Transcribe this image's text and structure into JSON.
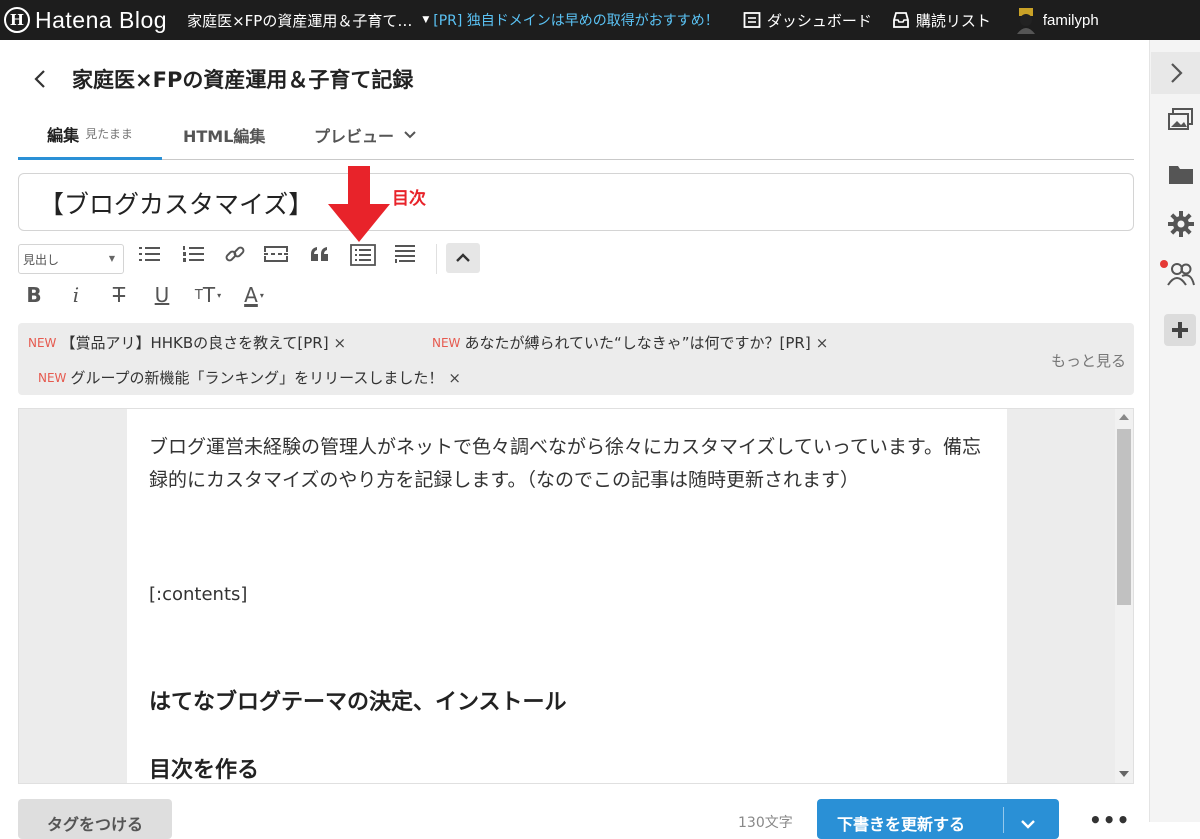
{
  "header": {
    "logo_mark": "H",
    "logo_text": "Hatena Blog",
    "blog_title": "家庭医×FPの資産運用＆子育て…",
    "pr_text": "[PR] 独自ドメインは早めの取得がおすすめ！",
    "nav": [
      {
        "label": "ダッシュボード",
        "icon": "dashboard-icon"
      },
      {
        "label": "購読リスト",
        "icon": "inbox-icon"
      }
    ],
    "username": "familyph"
  },
  "editor_header": {
    "blog_name": "家庭医×FPの資産運用＆子育て記録",
    "tabs": {
      "edit": "編集",
      "edit_sub": "見たまま",
      "html": "HTML編集",
      "preview": "プレビュー"
    }
  },
  "post": {
    "title": "【ブログカスタマイズ】",
    "annotation": "目次",
    "body": "ブログ運営未経験の管理人がネットで色々調べながら徐々にカスタマイズしていっています。備忘録的にカスタマイズのやり方を記録します。（なのでこの記事は随時更新されます）",
    "contents_tag": "[:contents]",
    "heading_1": "はてなブログテーマの決定、インストール",
    "heading_2": "目次を作る"
  },
  "toolbar": {
    "format_select": "見出し",
    "buttons": [
      "bulleted-list-icon",
      "numbered-list-icon",
      "link-icon",
      "more-separator-icon",
      "quote-icon",
      "table-of-contents-icon",
      "footnote-icon"
    ],
    "text_format": {
      "bold": "B",
      "italic": "i",
      "strike": "T",
      "underline": "U",
      "size": "T",
      "color": "A"
    }
  },
  "notices": {
    "badge": "NEW",
    "items": [
      "【賞品アリ】HHKBの良さを教えて[PR]",
      "あなたが縛られていた“しなきゃ”は何ですか？[PR]",
      "グループの新機能「ランキング」をリリースしました！"
    ],
    "close": "×",
    "more": "もっと見る"
  },
  "footer": {
    "tag_button": "タグをつける",
    "char_count": "130文字",
    "update_button": "下書きを更新する",
    "more": "•••"
  },
  "colors": {
    "header_bg": "#1d1d1d",
    "pr_link": "#5bc3f5",
    "accent": "#2a90d6",
    "annotation": "#e8232a",
    "new_badge": "#e65a4f"
  }
}
